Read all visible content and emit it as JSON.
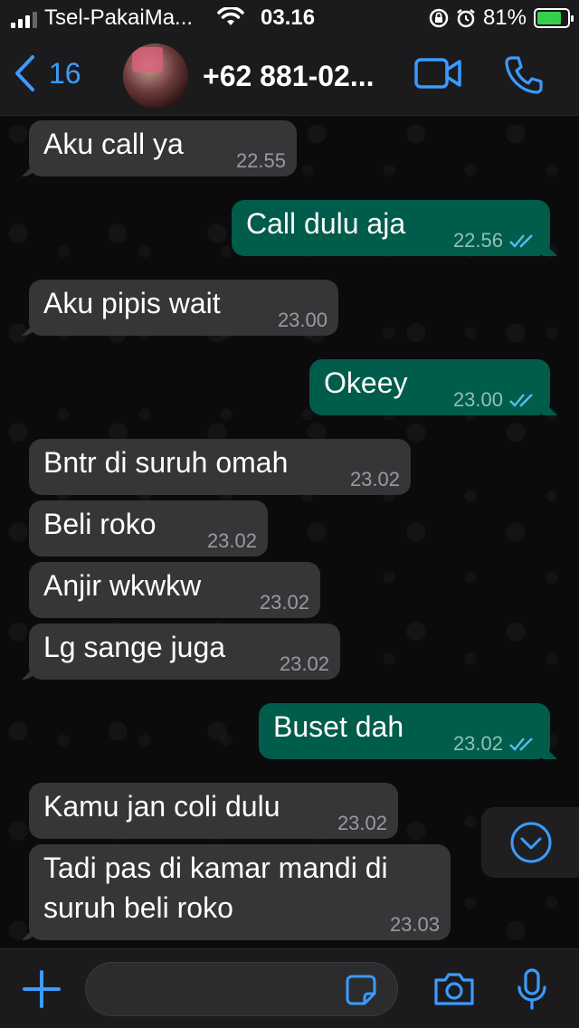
{
  "status_bar": {
    "carrier": "Tsel-PakaiMa...",
    "time": "03.16",
    "battery_percent": "81%",
    "battery_level": 0.81
  },
  "header": {
    "back_count": "16",
    "contact_name": "+62 881-02..."
  },
  "messages": [
    {
      "dir": "in",
      "text": "Aku call ya",
      "time": "22.55"
    },
    {
      "dir": "out",
      "text": "Call dulu aja",
      "time": "22.56",
      "read": true
    },
    {
      "dir": "in",
      "text": "Aku pipis wait",
      "time": "23.00"
    },
    {
      "dir": "out",
      "text": "Okeey",
      "time": "23.00",
      "read": true
    },
    {
      "dir": "in",
      "text": "Bntr di suruh omah",
      "time": "23.02"
    },
    {
      "dir": "in",
      "text": "Beli roko",
      "time": "23.02"
    },
    {
      "dir": "in",
      "text": "Anjir wkwkw",
      "time": "23.02"
    },
    {
      "dir": "in",
      "text": "Lg sange juga",
      "time": "23.02"
    },
    {
      "dir": "out",
      "text": "Buset dah",
      "time": "23.02",
      "read": true
    },
    {
      "dir": "in",
      "text": "Kamu jan coli dulu",
      "time": "23.02"
    },
    {
      "dir": "in",
      "text": "Tadi pas di kamar mandi di suruh beli roko",
      "time": "23.03"
    }
  ],
  "composer": {
    "placeholder": ""
  },
  "icons": {
    "back": "chevron-left-icon",
    "video": "video-camera-icon",
    "call": "phone-icon",
    "scroll": "chevron-down-circle-icon",
    "plus": "plus-icon",
    "sticker": "sticker-icon",
    "camera": "camera-icon",
    "mic": "microphone-icon"
  },
  "colors": {
    "accent": "#3b9bff",
    "incoming_bubble": "#363638",
    "outgoing_bubble": "#005c4b",
    "read_ticks": "#53bdeb"
  }
}
